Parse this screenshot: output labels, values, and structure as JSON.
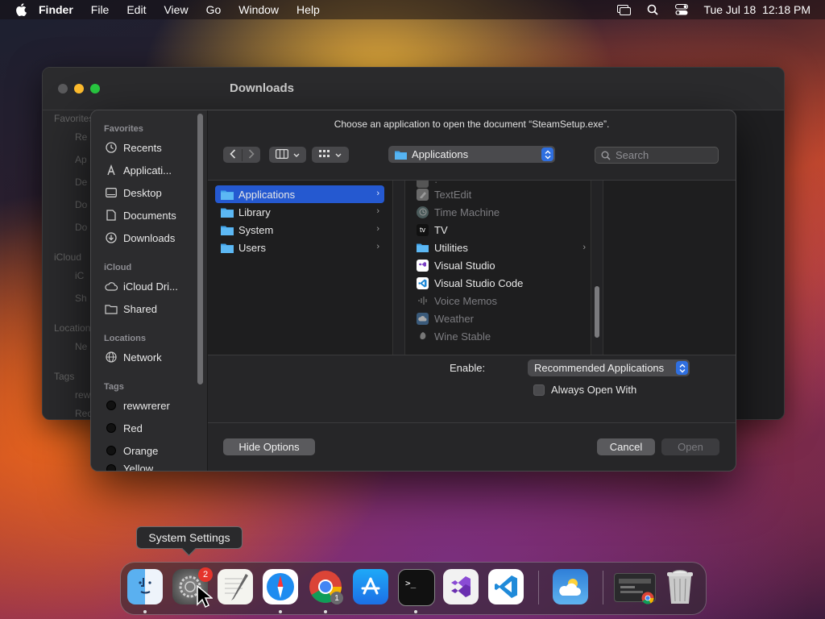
{
  "menubar": {
    "app": "Finder",
    "items": [
      "File",
      "Edit",
      "View",
      "Go",
      "Window",
      "Help"
    ],
    "datetime": "Tue Jul 18  12:18 PM"
  },
  "finder_window": {
    "title": "Downloads",
    "ghost_sidebar": [
      "Favorites",
      "Re",
      "Ap",
      "De",
      "Do",
      "Do",
      "iCloud",
      "iC",
      "Sh",
      "Locations",
      "Ne",
      "Tags",
      "rew",
      "Red"
    ]
  },
  "dialog": {
    "prompt": "Choose an application to open the document “SteamSetup.exe”.",
    "location": "Applications",
    "search_placeholder": "Search",
    "sidebar": {
      "favorites_header": "Favorites",
      "favorites": [
        "Recents",
        "Applicati...",
        "Desktop",
        "Documents",
        "Downloads"
      ],
      "icloud_header": "iCloud",
      "icloud": [
        "iCloud Dri...",
        "Shared"
      ],
      "locations_header": "Locations",
      "locations": [
        "Network"
      ],
      "tags_header": "Tags",
      "tags": [
        "rewwrerer",
        "Red",
        "Orange",
        "Yellow"
      ]
    },
    "column1": [
      "Applications",
      "Library",
      "System",
      "Users"
    ],
    "column2": [
      {
        "name": "TextEdit",
        "enabled": false
      },
      {
        "name": "Time Machine",
        "enabled": false
      },
      {
        "name": "TV",
        "enabled": true
      },
      {
        "name": "Utilities",
        "enabled": true
      },
      {
        "name": "Visual Studio",
        "enabled": true
      },
      {
        "name": "Visual Studio Code",
        "enabled": true
      },
      {
        "name": "Voice Memos",
        "enabled": false
      },
      {
        "name": "Weather",
        "enabled": false
      },
      {
        "name": "Wine Stable",
        "enabled": false
      }
    ],
    "enable_label": "Enable:",
    "enable_value": "Recommended Applications",
    "always_open_with": "Always Open With",
    "hide_options": "Hide Options",
    "cancel": "Cancel",
    "open": "Open"
  },
  "dock": {
    "tooltip": "System Settings",
    "settings_badge": "2",
    "chrome_badge": "1",
    "apps": [
      "finder-icon",
      "system-settings-icon",
      "textedit-icon",
      "safari-icon",
      "chrome-icon",
      "app-store-icon",
      "terminal-icon",
      "visual-studio-icon",
      "vscode-icon",
      "weather-icon",
      "chrome-window-icon",
      "trash-icon"
    ]
  },
  "colors": {
    "accent": "#2559d0",
    "popup_step": "#2f6fe0",
    "badge": "#e5342b"
  }
}
